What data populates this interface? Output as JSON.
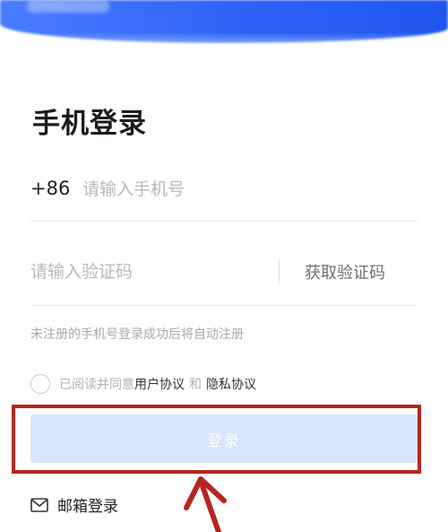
{
  "header": {
    "title": "手机登录"
  },
  "phone": {
    "country_code": "+86",
    "placeholder": "请输入手机号",
    "value": ""
  },
  "verification": {
    "placeholder": "请输入验证码",
    "value": "",
    "get_code_label": "获取验证码"
  },
  "hint": "未注册的手机号登录成功后将自动注册",
  "agreement": {
    "checked": false,
    "prefix": "已阅读并同意",
    "user_agreement": "用户协议",
    "and": "和",
    "privacy_agreement": "隐私协议"
  },
  "login_button": {
    "label": "登录"
  },
  "email_login": {
    "icon": "mail-icon",
    "label": "邮箱登录"
  },
  "colors": {
    "banner": "#2c62f6",
    "login_button_disabled": "#d7e5fd",
    "annotation": "#b52620"
  }
}
